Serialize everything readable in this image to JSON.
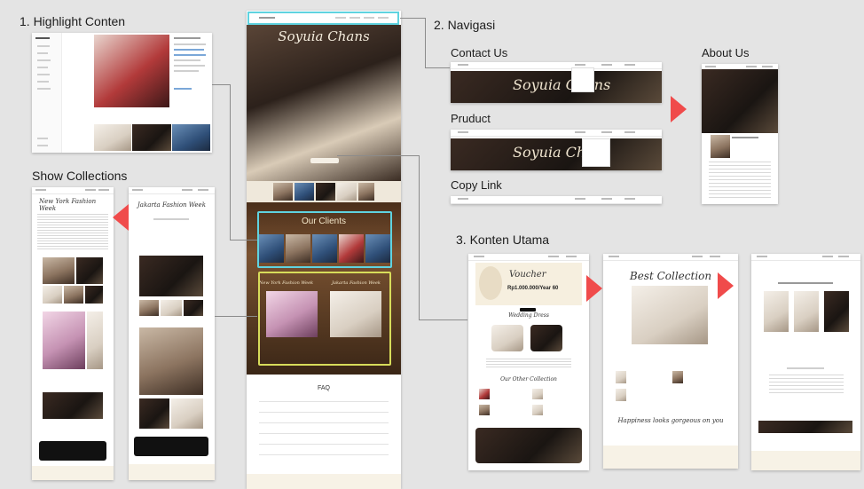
{
  "sections": {
    "highlight": "1. Highlight Conten",
    "navigasi": "2. Navigasi",
    "konten_utama": "3. Konten Utama",
    "show_collections": "Show Collections"
  },
  "nav_labels": {
    "contact": "Contact Us",
    "product": "Pruduct",
    "copy_link": "Copy Link",
    "about": "About Us"
  },
  "center_page": {
    "brand": "Soyuia Chans",
    "our_clients": "Our Clients",
    "collection_left": "New York Fashion Week",
    "collection_right": "Jakarta Fashion Week",
    "faq": "FAQ"
  },
  "main_content": {
    "voucher_title": "Voucher",
    "voucher_amount": "Rp1.000.000/Year 60",
    "wedding_dress": "Wedding Dress",
    "other_collection": "Our Other Collection",
    "best_collection": "Best Collection",
    "tagline": "Happiness looks gorgeous on you"
  },
  "colors": {
    "accent_red": "#f04b4b",
    "highlight_cyan": "#5fd3e0",
    "highlight_yellow": "#d7dc5a",
    "page_bg": "#e4e4e4"
  }
}
